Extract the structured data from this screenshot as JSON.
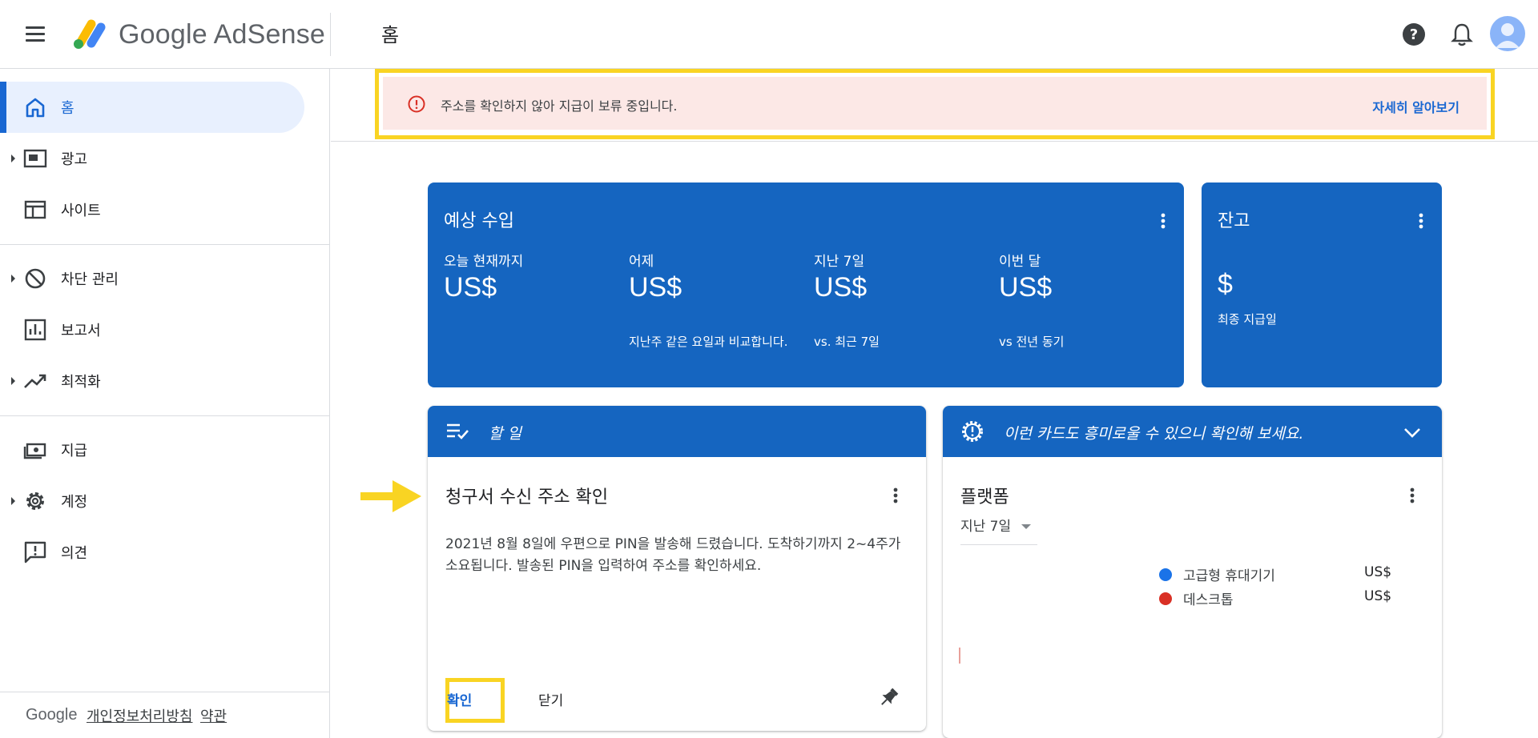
{
  "app": {
    "brand": "Google AdSense",
    "page_title": "홈"
  },
  "sidebar": {
    "items": [
      {
        "label": "홈",
        "icon": "home-icon",
        "active": true,
        "expandable": false
      },
      {
        "label": "광고",
        "icon": "ads-icon",
        "active": false,
        "expandable": true
      },
      {
        "label": "사이트",
        "icon": "sites-icon",
        "active": false,
        "expandable": false
      },
      {
        "label": "차단 관리",
        "icon": "block-icon",
        "active": false,
        "expandable": true
      },
      {
        "label": "보고서",
        "icon": "reports-icon",
        "active": false,
        "expandable": false
      },
      {
        "label": "최적화",
        "icon": "trending-up-icon",
        "active": false,
        "expandable": true
      },
      {
        "label": "지급",
        "icon": "payments-icon",
        "active": false,
        "expandable": false
      },
      {
        "label": "계정",
        "icon": "gear-icon",
        "active": false,
        "expandable": true
      },
      {
        "label": "의견",
        "icon": "feedback-icon",
        "active": false,
        "expandable": false
      }
    ],
    "footer": {
      "google": "Google",
      "privacy": "개인정보처리방침",
      "terms": "약관"
    }
  },
  "alert": {
    "text": "주소를 확인하지 않아 지급이 보류 중입니다.",
    "link": "자세히 알아보기"
  },
  "earnings": {
    "title": "예상 수입",
    "stats": [
      {
        "label": "오늘 현재까지",
        "value": "US$",
        "sub": ""
      },
      {
        "label": "어제",
        "value": "US$",
        "sub": "지난주 같은 요일과 비교합니다."
      },
      {
        "label": "지난 7일",
        "value": "US$",
        "sub": "vs. 최근 7일"
      },
      {
        "label": "이번 달",
        "value": "US$",
        "sub": "vs 전년 동기"
      }
    ]
  },
  "balance": {
    "title": "잔고",
    "value": "$",
    "sub": "최종 지급일"
  },
  "todo": {
    "header": "할 일",
    "title": "청구서 수신 주소 확인",
    "body": "2021년 8월 8일에 우편으로 PIN을 발송해 드렸습니다. 도착하기까지 2~4주가 소요됩니다. 발송된 PIN을 입력하여 주소를 확인하세요.",
    "confirm": "확인",
    "close": "닫기"
  },
  "suggest": {
    "header": "이런 카드도 흥미로울 수 있으니 확인해 보세요.",
    "title": "플랫폼",
    "range": "지난 7일",
    "legend": [
      {
        "name": "고급형 휴대기기",
        "value": "US$",
        "color": "#1a73e8"
      },
      {
        "name": "데스크톱",
        "value": "US$",
        "color": "#d93025"
      }
    ]
  },
  "colors": {
    "primary": "#1565c0",
    "highlight": "#f9d423",
    "alert_bg": "#fce8e6"
  }
}
